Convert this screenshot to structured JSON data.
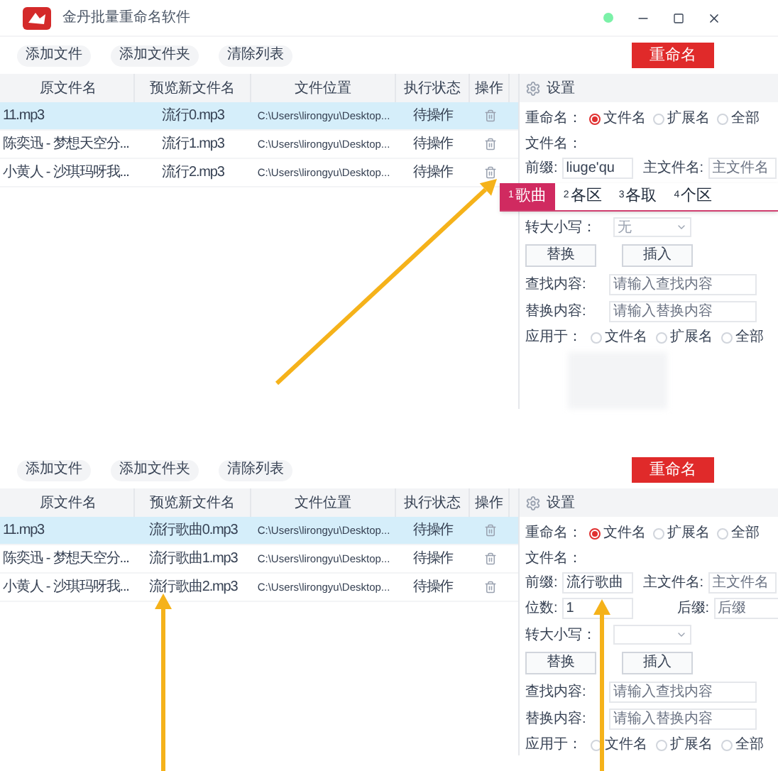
{
  "window": {
    "title": "金丹批量重命名软件"
  },
  "panels": [
    {
      "toolbar": {
        "buttons": [
          "添加文件",
          "添加文件夹",
          "清除列表"
        ],
        "primary": "重命名"
      },
      "table": {
        "columns": [
          "原文件名",
          "预览新文件名",
          "文件位置",
          "执行状态",
          "操作"
        ],
        "rows": [
          {
            "cells": [
              "11.mp3",
              "流行0.mp3",
              "C:\\Users\\lirongyu\\Desktop...",
              "待操作"
            ],
            "selected": true
          },
          {
            "cells": [
              "陈奕迅 - 梦想天空分...",
              "流行1.mp3",
              "C:\\Users\\lirongyu\\Desktop...",
              "待操作"
            ],
            "selected": false
          },
          {
            "cells": [
              "小黄人 - 沙琪玛呀我...",
              "流行2.mp3",
              "C:\\Users\\lirongyu\\Desktop...",
              "待操作"
            ],
            "selected": false
          }
        ]
      },
      "settings": {
        "header": "设置",
        "rename_target": {
          "label": "重命名：",
          "options": [
            {
              "label": "文件名",
              "selected": true
            },
            {
              "label": "扩展名",
              "selected": false
            },
            {
              "label": "全部",
              "selected": false
            }
          ]
        },
        "filename_label": "文件名：",
        "prefix": {
          "label": "前缀:",
          "value": "liuge'qu"
        },
        "main_name": {
          "label": "主文件名:",
          "placeholder": "主文件名"
        },
        "ime": {
          "candidates": [
            {
              "index": "1",
              "text": "歌曲",
              "selected": true
            },
            {
              "index": "2",
              "text": "各区",
              "selected": false
            },
            {
              "index": "3",
              "text": "各取",
              "selected": false
            },
            {
              "index": "4",
              "text": "个区",
              "selected": false
            }
          ]
        },
        "case": {
          "label": "转大小写：",
          "value": "无"
        },
        "buttons": [
          "替换",
          "插入"
        ],
        "find": {
          "label": "查找内容:",
          "placeholder": "请输入查找内容"
        },
        "replace": {
          "label": "替换内容:",
          "placeholder": "请输入替换内容"
        },
        "apply_to": {
          "label": "应用于：",
          "options": [
            {
              "label": "文件名",
              "selected": false
            },
            {
              "label": "扩展名",
              "selected": false
            },
            {
              "label": "全部",
              "selected": false
            }
          ]
        },
        "obscured": true
      }
    },
    {
      "toolbar": {
        "buttons": [
          "添加文件",
          "添加文件夹",
          "清除列表"
        ],
        "primary": "重命名"
      },
      "table": {
        "columns": [
          "原文件名",
          "预览新文件名",
          "文件位置",
          "执行状态",
          "操作"
        ],
        "rows": [
          {
            "cells": [
              "11.mp3",
              "流行歌曲0.mp3",
              "C:\\Users\\lirongyu\\Desktop...",
              "待操作"
            ],
            "selected": true
          },
          {
            "cells": [
              "陈奕迅 - 梦想天空分...",
              "流行歌曲1.mp3",
              "C:\\Users\\lirongyu\\Desktop...",
              "待操作"
            ],
            "selected": false
          },
          {
            "cells": [
              "小黄人 - 沙琪玛呀我...",
              "流行歌曲2.mp3",
              "C:\\Users\\lirongyu\\Desktop...",
              "待操作"
            ],
            "selected": false
          }
        ]
      },
      "settings": {
        "header": "设置",
        "rename_target": {
          "label": "重命名：",
          "options": [
            {
              "label": "文件名",
              "selected": true
            },
            {
              "label": "扩展名",
              "selected": false
            },
            {
              "label": "全部",
              "selected": false
            }
          ]
        },
        "filename_label": "文件名：",
        "prefix": {
          "label": "前缀:",
          "value": "流行歌曲"
        },
        "main_name": {
          "label": "主文件名:",
          "placeholder": "主文件名"
        },
        "digits": {
          "label": "位数:",
          "value": "1"
        },
        "suffix": {
          "label": "后缀:",
          "placeholder": "后缀"
        },
        "case": {
          "label": "转大小写："
        },
        "buttons": [
          "替换",
          "插入"
        ],
        "find": {
          "label": "查找内容:",
          "placeholder": "请输入查找内容"
        },
        "replace": {
          "label": "替换内容:",
          "placeholder": "请输入替换内容"
        },
        "apply_to": {
          "label": "应用于：",
          "options": [
            {
              "label": "文件名",
              "selected": false
            },
            {
              "label": "扩展名",
              "selected": false
            },
            {
              "label": "全部",
              "selected": false
            }
          ]
        }
      }
    }
  ]
}
